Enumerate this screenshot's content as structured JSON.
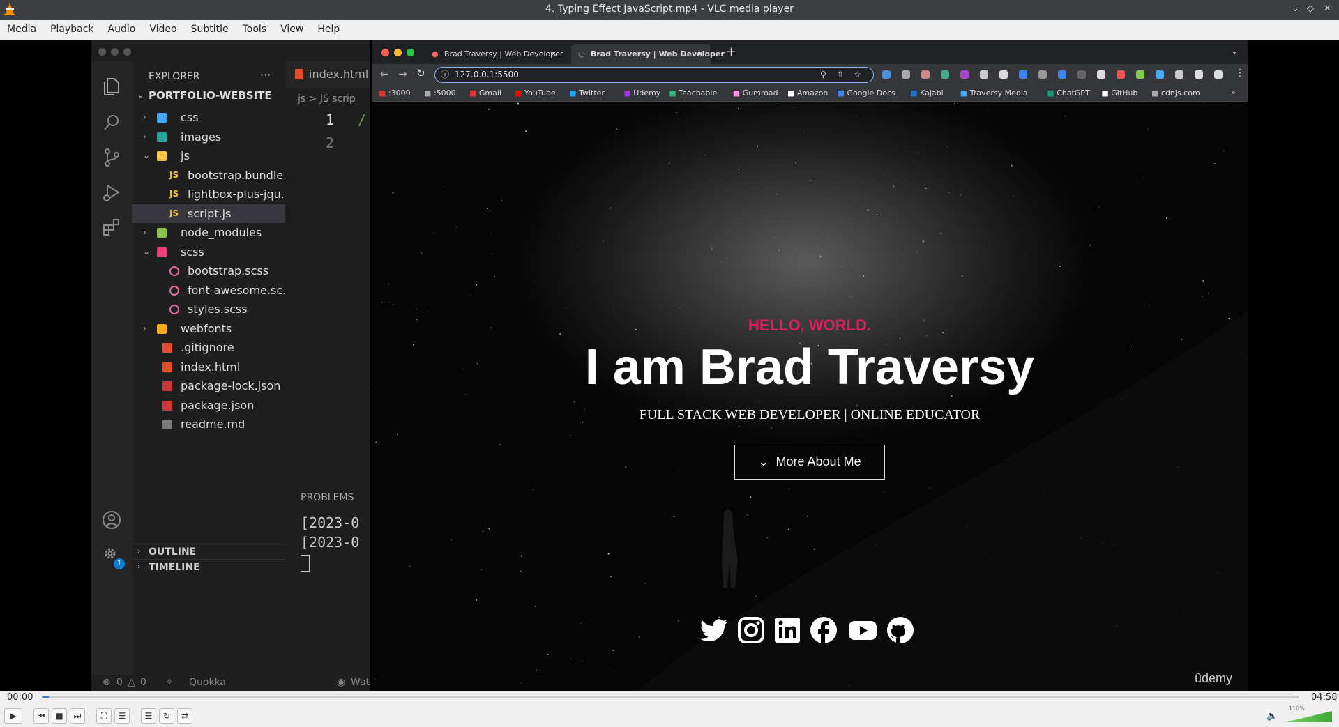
{
  "window": {
    "title": "4. Typing Effect JavaScript.mp4 - VLC media player"
  },
  "menu": [
    "Media",
    "Playback",
    "Audio",
    "Video",
    "Subtitle",
    "Tools",
    "View",
    "Help"
  ],
  "vscode": {
    "explorer_title": "EXPLORER",
    "project": "PORTFOLIO-WEBSITE",
    "tree": [
      {
        "name": "css",
        "type": "folder",
        "open": false,
        "depth": 1,
        "color": "#42a5f5"
      },
      {
        "name": "images",
        "type": "folder",
        "open": false,
        "depth": 1,
        "color": "#26a69a"
      },
      {
        "name": "js",
        "type": "folder",
        "open": true,
        "depth": 1,
        "color": "#f5c542"
      },
      {
        "name": "bootstrap.bundle...",
        "type": "js",
        "depth": 2
      },
      {
        "name": "lightbox-plus-jqu...",
        "type": "js",
        "depth": 2
      },
      {
        "name": "script.js",
        "type": "js",
        "depth": 2,
        "selected": true
      },
      {
        "name": "node_modules",
        "type": "folder",
        "open": false,
        "depth": 1,
        "color": "#8bc34a"
      },
      {
        "name": "scss",
        "type": "folder",
        "open": true,
        "depth": 1,
        "color": "#ec407a"
      },
      {
        "name": "bootstrap.scss",
        "type": "scss",
        "depth": 2
      },
      {
        "name": "font-awesome.sc...",
        "type": "scss",
        "depth": 2
      },
      {
        "name": "styles.scss",
        "type": "scss",
        "depth": 2
      },
      {
        "name": "webfonts",
        "type": "folder",
        "open": false,
        "depth": 1,
        "color": "#ffa726"
      },
      {
        "name": ".gitignore",
        "type": "git",
        "depth": 1
      },
      {
        "name": "index.html",
        "type": "html",
        "depth": 1
      },
      {
        "name": "package-lock.json",
        "type": "json",
        "depth": 1
      },
      {
        "name": "package.json",
        "type": "json",
        "depth": 1
      },
      {
        "name": "readme.md",
        "type": "md",
        "depth": 1
      }
    ],
    "editor_tab": "index.html",
    "breadcrumb": "js > JS scrip",
    "line_numbers": [
      "1",
      "2"
    ],
    "line1_text": "/",
    "panel_title": "PROBLEMS",
    "terminal_lines": [
      "[2023-0",
      "[2023-0"
    ],
    "outline": "OUTLINE",
    "timeline": "TIMELINE",
    "status": {
      "errors": "0",
      "warnings": "0",
      "extension": "Quokka",
      "watch": "Wat"
    },
    "settings_badge": "1"
  },
  "browser": {
    "tabs": [
      "Brad Traversy | Web Developer",
      "Brad Traversy | Web Developer"
    ],
    "url": "127.0.0.1:5500",
    "bookmarks": [
      ":3000",
      ":5000",
      "Gmail",
      "YouTube",
      "Twitter",
      "Udemy",
      "Teachable",
      "Gumroad",
      "Amazon",
      "Google Docs",
      "Kajabi",
      "Traversy Media",
      "ChatGPT",
      "GitHub",
      "cdnjs.com"
    ],
    "bookmark_more": "»",
    "page": {
      "hello": "HELLO, WORLD.",
      "title": "I am Brad Traversy",
      "subtitle": "FULL STACK WEB DEVELOPER | ONLINE EDUCATOR",
      "button": "More About Me",
      "socials": [
        "twitter-icon",
        "instagram-icon",
        "linkedin-icon",
        "facebook-icon",
        "youtube-icon",
        "github-icon"
      ],
      "watermark": "ûdemy"
    }
  },
  "player": {
    "time_current": "00:00",
    "time_total": "04:58",
    "progress": 0.005,
    "volume_label": "110%",
    "volume": 1.1
  }
}
